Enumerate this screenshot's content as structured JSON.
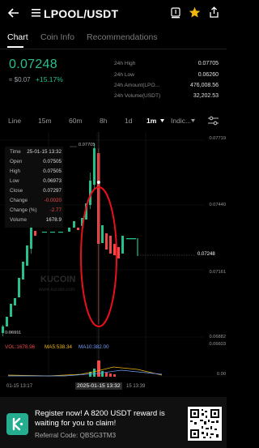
{
  "header": {
    "title": "LPOOL/USDT",
    "back_icon": "arrow-left",
    "menu_icon": "list-lines",
    "alert_icon": "bell-alert",
    "favorite_icon": "star",
    "share_icon": "share"
  },
  "tabs": [
    {
      "label": "Chart"
    },
    {
      "label": "Coin Info"
    },
    {
      "label": "Recommendations"
    }
  ],
  "summary": {
    "price": "0.07248",
    "fiat": "≈ $0.07",
    "change": "+15.17%",
    "up_color": "#27c08a",
    "down_color": "#f04848"
  },
  "stats": [
    {
      "label": "24h High",
      "value": "0.07705"
    },
    {
      "label": "24h Low",
      "value": "0.06260"
    },
    {
      "label": "24h Amount(LPO...",
      "value": "476,008.56"
    },
    {
      "label": "24h Volume(USDT)",
      "value": "32,202.53"
    }
  ],
  "intervals": [
    "Line",
    "15m",
    "60m",
    "8h",
    "1d",
    "1m",
    "Indic..."
  ],
  "active_interval": "1m",
  "ohlc_panel": [
    {
      "label": "Time",
      "value": "25-01-15 13:32"
    },
    {
      "label": "Open",
      "value": "0.07505"
    },
    {
      "label": "High",
      "value": "0.07505"
    },
    {
      "label": "Low",
      "value": "0.06973"
    },
    {
      "label": "Close",
      "value": "0.07297"
    },
    {
      "label": "Change",
      "value": "-0.0020"
    },
    {
      "label": "Change (%)",
      "value": "-2.77"
    },
    {
      "label": "Volume",
      "value": "1678.9"
    }
  ],
  "axis": {
    "right_ticks": [
      "0.07719",
      "0.07440",
      "0.07161",
      "0.06882",
      "0.06603"
    ],
    "last_price_label": "0.07248",
    "high_marker": "0.07705",
    "low_marker": "0.06911",
    "vol_ticks": [
      "0.00"
    ],
    "time_ticks": [
      "01-15 13:17",
      "2025-01-15 13:32",
      "15 13:39"
    ]
  },
  "indicators": {
    "vol": "VOL:1678.96",
    "ma5": "MA5:538.34",
    "ma10": "MA10:382.00"
  },
  "watermark": {
    "brand": "KUCOIN",
    "site": "www.kucoin.com"
  },
  "banner": {
    "line1": "Register now! A 8200 USDT reward is",
    "line2": "waiting for you to claim!",
    "referral": "Referral Code: QBSG3TM3"
  }
}
